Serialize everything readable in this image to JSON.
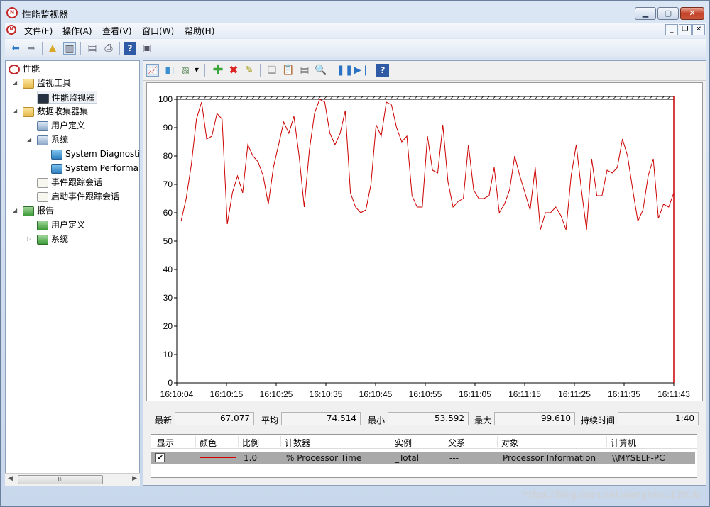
{
  "window": {
    "title": "性能监视器"
  },
  "menu": [
    "文件(F)",
    "操作(A)",
    "查看(V)",
    "窗口(W)",
    "帮助(H)"
  ],
  "tree": {
    "root": "性能",
    "monitor_tools": "监视工具",
    "perf_monitor": "性能监视器",
    "collector_sets": "数据收集器集",
    "user_defined": "用户定义",
    "system": "系统",
    "sys_diag": "System Diagnostics",
    "sys_perf": "System Performance",
    "event_trace": "事件跟踪会话",
    "startup_trace": "启动事件跟踪会话",
    "reports": "报告",
    "reports_user": "用户定义",
    "reports_system": "系统"
  },
  "scroll_glyph": "III",
  "stats": {
    "last_label": "最新",
    "last": "67.077",
    "avg_label": "平均",
    "avg": "74.514",
    "min_label": "最小",
    "min": "53.592",
    "max_label": "最大",
    "max": "99.610",
    "dur_label": "持续时间",
    "dur": "1:40"
  },
  "legend": {
    "headers": [
      "显示",
      "颜色",
      "比例",
      "计数器",
      "实例",
      "父系",
      "对象",
      "计算机"
    ],
    "row": {
      "check": "✔",
      "scale": "1.0",
      "counter": "% Processor Time",
      "instance": "_Total",
      "parent": "---",
      "object": "Processor Information",
      "computer": "\\\\MYSELF-PC"
    }
  },
  "watermark": "https://blog.csdn.net/wanghao112956",
  "colors": {
    "series": "#cc0000",
    "title_close": "#c3442a"
  },
  "chart_data": {
    "type": "line",
    "ylim": [
      0,
      100
    ],
    "y_ticks": [
      0,
      10,
      20,
      30,
      40,
      50,
      60,
      70,
      80,
      90,
      100
    ],
    "x_ticks": [
      "16:10:04",
      "16:10:15",
      "16:10:25",
      "16:10:35",
      "16:10:45",
      "16:10:55",
      "16:11:05",
      "16:11:15",
      "16:11:25",
      "16:11:35",
      "16:11:43"
    ],
    "series": [
      {
        "values": [
          57,
          65,
          77,
          93,
          99,
          86,
          87,
          95,
          93,
          56,
          67,
          73,
          67,
          84,
          80,
          78,
          73,
          63,
          76,
          84,
          92,
          88,
          94,
          80,
          62,
          82,
          95,
          100,
          99,
          88,
          84,
          88,
          96,
          67,
          62,
          60,
          61,
          70,
          91,
          87,
          99,
          98,
          90,
          85,
          87,
          66,
          62,
          62,
          87,
          75,
          74,
          91,
          71,
          62,
          64,
          65,
          84,
          68,
          65,
          65,
          66,
          76,
          60,
          63,
          68,
          80,
          73,
          67,
          61,
          76,
          54,
          60,
          60,
          62,
          59,
          54,
          73,
          84,
          68,
          54,
          79,
          66,
          66,
          75,
          74,
          76,
          86,
          80,
          68,
          57,
          61,
          73,
          79,
          58,
          63,
          62,
          67
        ]
      }
    ]
  }
}
